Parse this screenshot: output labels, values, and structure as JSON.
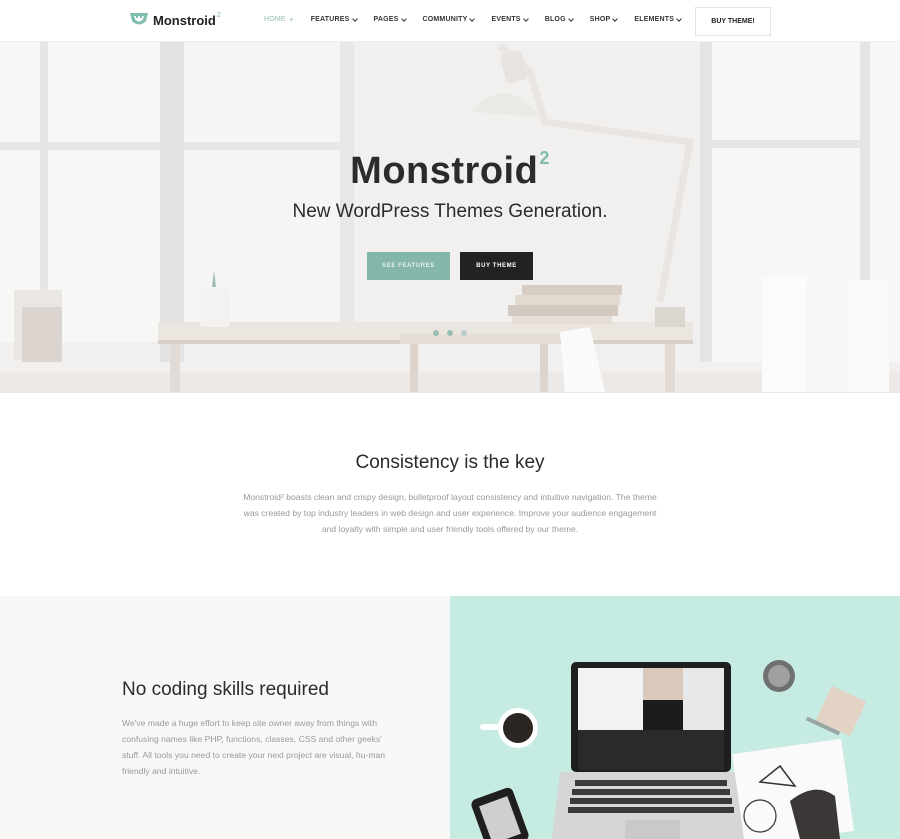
{
  "header": {
    "logo_text": "Monstroid",
    "logo_sup": "2",
    "nav": [
      {
        "label": "HOME",
        "suffix": "+"
      },
      {
        "label": "FEATURES"
      },
      {
        "label": "PAGES"
      },
      {
        "label": "COMMUNITY"
      },
      {
        "label": "EVENTS"
      },
      {
        "label": "BLOG"
      },
      {
        "label": "SHOP"
      },
      {
        "label": "ELEMENTS"
      }
    ],
    "buy_button": "BUY THEME!"
  },
  "hero": {
    "title": "Monstroid",
    "title_sup": "2",
    "subtitle": "New WordPress Themes Generation.",
    "btn_features": "SEE FEATURES",
    "btn_buy": "BUY THEME"
  },
  "consistency": {
    "heading": "Consistency is the key",
    "text": "Monstroid² boasts clean and crispy design, bulletproof layout consistency and intuitive navigation. The theme was created by top industry leaders in web design and user experience. Improve your audience engagement and loyalty with simple and user friendly tools offered by our theme."
  },
  "nocode": {
    "heading": "No coding skills required",
    "text": "We've made a huge effort to keep site owner away from things with confusing names like PHP, functions, classes, CSS and other geeks' stuff. All tools you need to create your next project are visual, hu-man friendly and intuitive."
  },
  "colors": {
    "accent": "#84b6aa",
    "dark": "#222222",
    "mint_bg": "#c6ebe3"
  }
}
